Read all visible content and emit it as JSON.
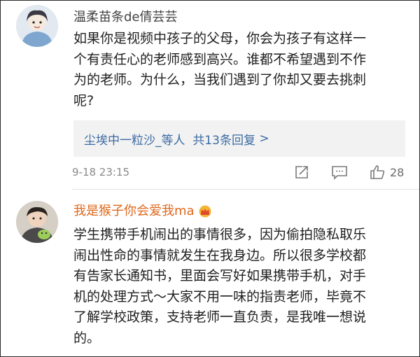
{
  "comment1": {
    "username": "温柔苗条de倩芸芸",
    "lines": [
      "如果你是视频中孩子的父母，你会为孩子有这样一",
      "个有责任心的老师感到高兴。谁都不希望遇到不作",
      "为的老师。为什么，当我们遇到了你却又要去挑刺",
      "呢?"
    ],
    "replies": {
      "name": "尘埃中一粒沙_",
      "suffix": "等人",
      "count": "共13条回复",
      "arrow": ">"
    },
    "timestamp": "9-18 23:15",
    "likes": "28"
  },
  "comment2": {
    "username": "我是猴子你会爱我ma",
    "lines": [
      "学生携带手机闹出的事情很多，因为偷拍隐私取乐",
      "闹出性命的事情就发生在我身边。所以很多学校都",
      "有告家长通知书，里面会写好如果携带手机，对手",
      "机的处理方式～大家不用一味的指责老师，毕竟不",
      "了解学校政策，支持老师一直负责，是我唯一想说",
      "的。"
    ]
  },
  "colors": {
    "link_blue": "#3c6ba4",
    "vip_orange": "#e0681c",
    "reply_bg": "#f2f2f2"
  },
  "icons": [
    "share-icon",
    "comment-icon",
    "like-icon",
    "crown-icon"
  ]
}
